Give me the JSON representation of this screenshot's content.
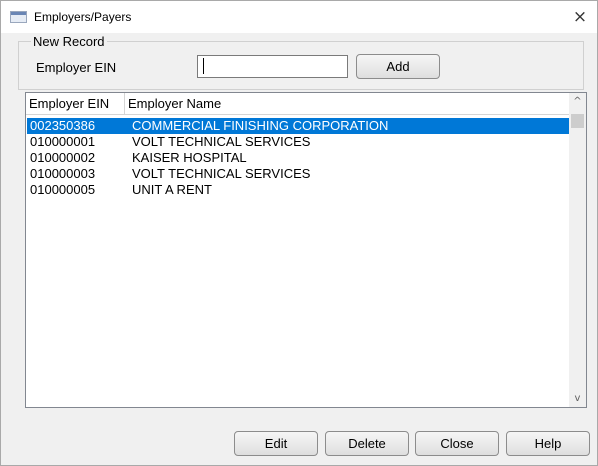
{
  "window": {
    "title": "Employers/Payers",
    "close_glyph": "×"
  },
  "new_record": {
    "legend": "New Record",
    "ein_label": "Employer EIN",
    "ein_value": "",
    "add_label": "Add"
  },
  "list": {
    "columns": [
      "Employer EIN",
      "Employer Name"
    ],
    "rows": [
      {
        "ein": "002350386",
        "name": "COMMERCIAL FINISHING CORPORATION",
        "selected": true
      },
      {
        "ein": "010000001",
        "name": "VOLT TECHNICAL SERVICES",
        "selected": false
      },
      {
        "ein": "010000002",
        "name": "KAISER HOSPITAL",
        "selected": false
      },
      {
        "ein": "010000003",
        "name": "VOLT TECHNICAL SERVICES",
        "selected": false
      },
      {
        "ein": "010000005",
        "name": "UNIT A RENT",
        "selected": false
      }
    ],
    "scroll_up_glyph": "^",
    "scroll_down_glyph": "v"
  },
  "buttons": {
    "edit": "Edit",
    "delete": "Delete",
    "close": "Close",
    "help": "Help"
  },
  "colors": {
    "selection": "#0078d7",
    "selection_text": "#ffffff"
  }
}
